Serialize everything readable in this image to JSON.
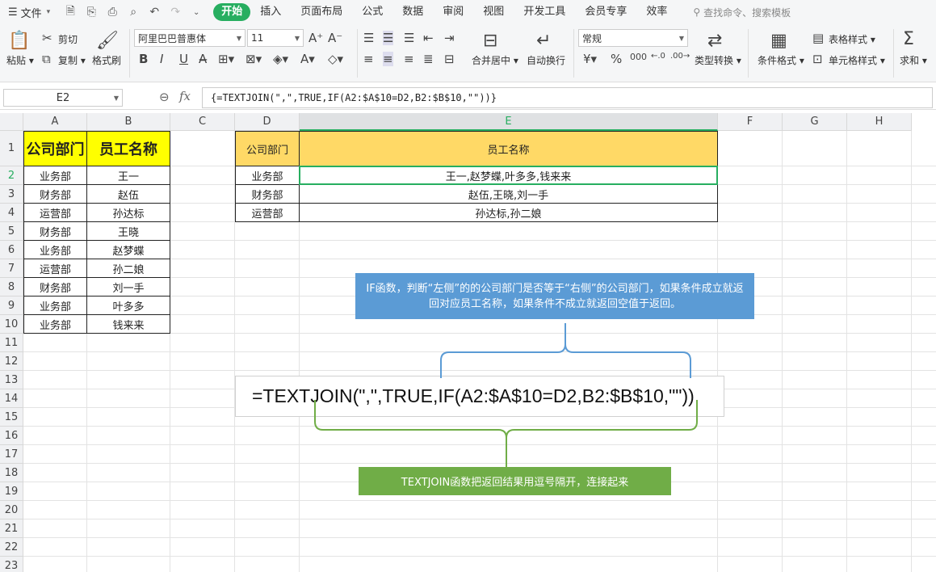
{
  "menubar": {
    "file_label": "文件",
    "tabs": [
      "开始",
      "插入",
      "页面布局",
      "公式",
      "数据",
      "审阅",
      "视图",
      "开发工具",
      "会员专享",
      "效率"
    ],
    "search_placeholder": "查找命令、搜索模板"
  },
  "ribbon": {
    "paste": "粘贴",
    "cut": "剪切",
    "copy": "复制",
    "format_painter": "格式刷",
    "font_name": "阿里巴巴普惠体",
    "font_size": "11",
    "merge_center": "合并居中",
    "wrap_text": "自动换行",
    "number_format": "常规",
    "type_convert": "类型转换",
    "conditional_format": "条件格式",
    "table_style": "表格样式",
    "cell_style": "单元格样式",
    "sum": "求和"
  },
  "formula_bar": {
    "name_box": "E2",
    "fx": "fx",
    "formula": "{=TEXTJOIN(\",\",TRUE,IF(A2:$A$10=D2,B2:$B$10,\"\"))}"
  },
  "columns": [
    "A",
    "B",
    "C",
    "D",
    "E",
    "F",
    "G",
    "H"
  ],
  "rows": [
    "1",
    "2",
    "3",
    "4",
    "5",
    "6",
    "7",
    "8",
    "9",
    "10",
    "11",
    "12",
    "13",
    "14",
    "15",
    "16",
    "17",
    "18",
    "19",
    "20",
    "21",
    "22",
    "23"
  ],
  "table1": {
    "header": [
      "公司部门",
      "员工名称"
    ],
    "rows": [
      [
        "业务部",
        "王一"
      ],
      [
        "财务部",
        "赵伍"
      ],
      [
        "运营部",
        "孙达标"
      ],
      [
        "财务部",
        "王晓"
      ],
      [
        "业务部",
        "赵梦蝶"
      ],
      [
        "运营部",
        "孙二娘"
      ],
      [
        "财务部",
        "刘一手"
      ],
      [
        "业务部",
        "叶多多"
      ],
      [
        "业务部",
        "钱来来"
      ]
    ]
  },
  "table2": {
    "header": [
      "公司部门",
      "员工名称"
    ],
    "rows": [
      [
        "业务部",
        "王一,赵梦蝶,叶多多,钱来来"
      ],
      [
        "财务部",
        "赵伍,王晓,刘一手"
      ],
      [
        "运营部",
        "孙达标,孙二娘"
      ]
    ]
  },
  "annotations": {
    "if_note": "IF函数，判断“左侧”的的公司部门是否等于“右侧”的公司部门，如果条件成立就返回对应员工名称，如果条件不成立就返回空值于返回。",
    "big_formula": "=TEXTJOIN(\",\",TRUE,IF(A2:$A$10=D2,B2:$B$10,\"\"))",
    "textjoin_note": "TEXTJOIN函数把返回结果用逗号隔开，连接起来"
  },
  "colors": {
    "accent": "#27ae60",
    "header_yellow": "#ffff00",
    "header_gold": "#ffd966",
    "note_blue": "#5b9bd5",
    "note_green": "#70ad47"
  }
}
